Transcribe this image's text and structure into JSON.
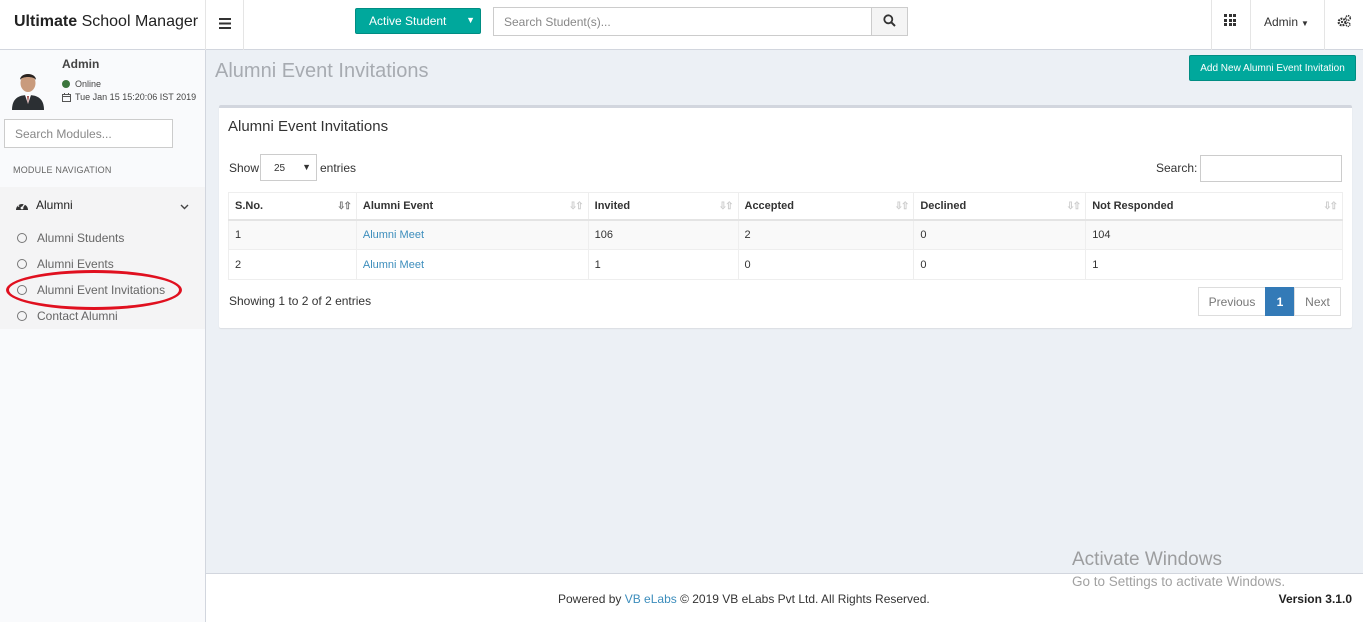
{
  "header": {
    "brand_bold": "Ultimate",
    "brand_rest": " School Manager",
    "active_student_label": "Active Student",
    "search_placeholder": "Search Student(s)...",
    "admin_label": "Admin"
  },
  "sidebar": {
    "user_name": "Admin",
    "status": "Online",
    "timestamp": "Tue Jan 15 15:20:06 IST 2019",
    "module_search_placeholder": "Search Modules...",
    "nav_header": "MODULE NAVIGATION",
    "group_label": "Alumni",
    "items": [
      {
        "label": "Alumni Students"
      },
      {
        "label": "Alumni Events"
      },
      {
        "label": "Alumni Event Invitations"
      },
      {
        "label": "Contact Alumni"
      }
    ]
  },
  "main": {
    "page_title": "Alumni Event Invitations",
    "add_button": "Add New Alumni Event Invitation",
    "box_title": "Alumni Event Invitations",
    "show_label": "Show",
    "entries_value": "25",
    "entries_label": "entries",
    "search_label": "Search:",
    "columns": [
      "S.No.",
      "Alumni Event",
      "Invited",
      "Accepted",
      "Declined",
      "Not Responded"
    ],
    "rows": [
      [
        "1",
        "Alumni Meet",
        "106",
        "2",
        "0",
        "104"
      ],
      [
        "2",
        "Alumni Meet",
        "1",
        "0",
        "0",
        "1"
      ]
    ],
    "showing_text": "Showing 1 to 2 of 2 entries",
    "pagination": {
      "previous": "Previous",
      "current": "1",
      "next": "Next"
    }
  },
  "footer": {
    "powered_by": "Powered by ",
    "company_link": "VB eLabs",
    "copyright": " © 2019 VB eLabs Pvt Ltd. All Rights Reserved.",
    "version": "Version 3.1.0"
  },
  "watermark": {
    "line1": "Activate Windows",
    "line2": "Go to Settings to activate Windows."
  },
  "colors": {
    "accent": "#00a89c",
    "link": "#3c8dbc",
    "page_primary": "#337ab7",
    "highlight": "#e0101f"
  },
  "icons": {
    "menu": "hamburger-icon",
    "search": "search-icon",
    "apps": "grid-icon",
    "settings": "cogs-icon",
    "group": "dashboard-icon"
  }
}
